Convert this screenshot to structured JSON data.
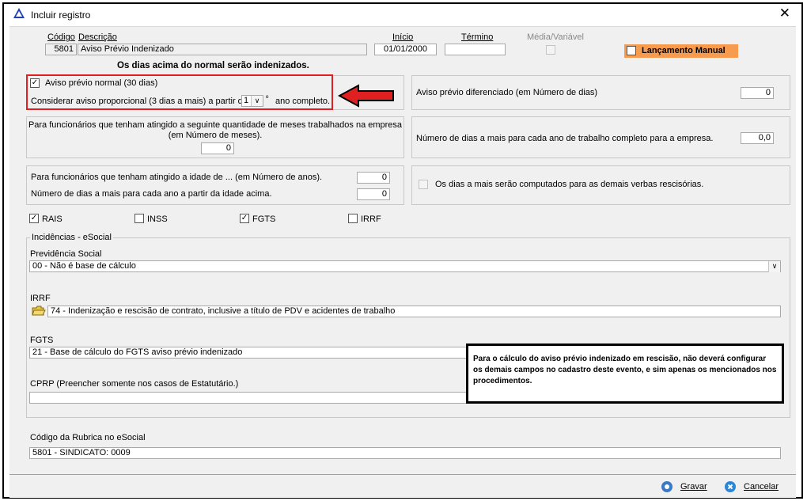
{
  "window": {
    "title": "Incluir registro"
  },
  "header": {
    "codigo_label": "Código",
    "codigo_value": "5801",
    "descricao_label": "Descrição",
    "descricao_value": "Aviso Prévio Indenizado",
    "inicio_label": "Início",
    "inicio_value": "01/01/2000",
    "termino_label": "Término",
    "termino_value": "",
    "media_label": "Média/Variável",
    "lancamento_label": "Lançamento Manual",
    "notice": "Os dias acima do normal serão indenizados."
  },
  "aviso_normal": {
    "checkbox_label": "Aviso prévio normal (30 dias)",
    "checked": true,
    "proporcional_label_before": "Considerar aviso proporcional (3 dias a mais) a partir do",
    "proporcional_value": "1",
    "proporcional_label_after": "ano completo.",
    "ordinal": "º"
  },
  "aviso_diferenciado": {
    "label": "Aviso prévio diferenciado (em Número de dias)",
    "value": "0"
  },
  "meses": {
    "label_line1": "Para funcionários que tenham atingido a seguinte quantidade de meses trabalhados na empresa",
    "label_line2": "(em Número de meses).",
    "value": "0"
  },
  "dias_ano": {
    "label": "Número de dias a mais para cada ano de trabalho completo para a empresa.",
    "value": "0,0"
  },
  "idade": {
    "label_idade": "Para funcionários que tenham atingido a idade de ...  (em Número de anos).",
    "value_idade": "0",
    "label_dias": "Número de dias a mais para cada ano a partir da idade acima.",
    "value_dias": "0"
  },
  "computados": {
    "label": "Os dias a mais serão computados para as demais verbas rescisórias."
  },
  "incidencias_flags": [
    {
      "label": "RAIS",
      "checked": true
    },
    {
      "label": "INSS",
      "checked": false
    },
    {
      "label": "FGTS",
      "checked": true
    },
    {
      "label": "IRRF",
      "checked": false
    }
  ],
  "esocial": {
    "group_title": "Incidências - eSocial",
    "previdencia_label": "Previdência Social",
    "previdencia_value": "00 - Não é base de cálculo",
    "irrf_label": "IRRF",
    "irrf_value": "74 - Indenização e rescisão de contrato, inclusive a título de PDV e acidentes de trabalho",
    "fgts_label": "FGTS",
    "fgts_value": "21 - Base de cálculo do FGTS aviso prévio indenizado",
    "cprp_label": "CPRP (Preencher somente nos casos de Estatutário.)",
    "cprp_value": ""
  },
  "rubrica": {
    "label": "Código da Rubrica no eSocial",
    "value": "5801 - SINDICATO: 0009"
  },
  "callout": {
    "text": "Para o cálculo do aviso prévio indenizado em rescisão, não deverá configurar os demais campos no cadastro deste evento, e sim apenas os mencionados nos procedimentos."
  },
  "footer": {
    "gravar_label": "Gravar",
    "cancelar_label": "Cancelar"
  },
  "colors": {
    "highlight_red": "#e02020",
    "lancamento_bg": "#f79b4f",
    "gravar_icon": "#3a78c8",
    "cancelar_icon": "#2a86d8"
  }
}
